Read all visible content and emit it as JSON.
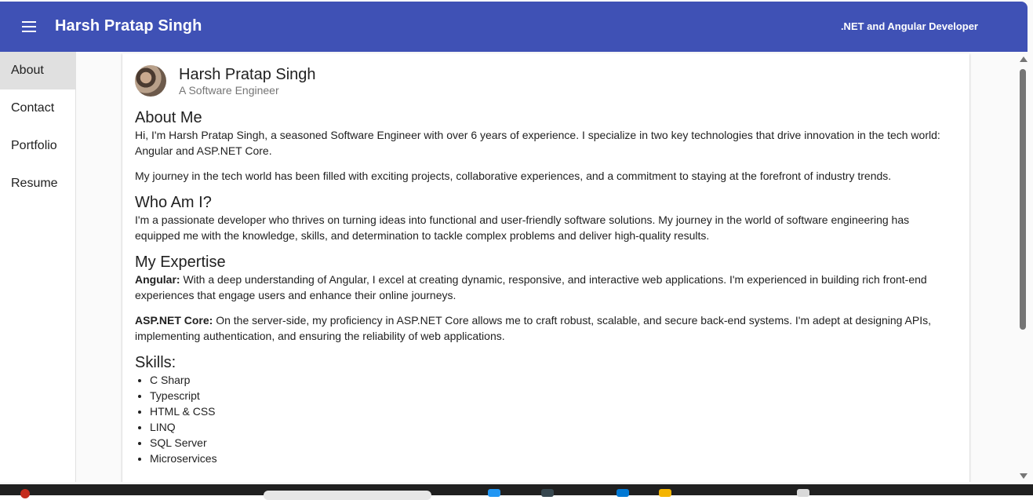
{
  "toolbar": {
    "title": "Harsh Pratap Singh",
    "tagline": ".NET and Angular Developer"
  },
  "sidenav": {
    "items": [
      {
        "label": "About",
        "active": true
      },
      {
        "label": "Contact",
        "active": false
      },
      {
        "label": "Portfolio",
        "active": false
      },
      {
        "label": "Resume",
        "active": false
      }
    ]
  },
  "profile": {
    "name": "Harsh Pratap Singh",
    "subtitle": "A Software Engineer"
  },
  "about": {
    "heading": "About Me",
    "p1": "Hi, I'm Harsh Pratap Singh, a seasoned Software Engineer with over 6 years of experience. I specialize in two key technologies that drive innovation in the tech world: Angular and ASP.NET Core.",
    "p2": "My journey in the tech world has been filled with exciting projects, collaborative experiences, and a commitment to staying at the forefront of industry trends."
  },
  "who": {
    "heading": "Who Am I?",
    "p1": "I'm a passionate developer who thrives on turning ideas into functional and user-friendly software solutions. My journey in the world of software engineering has equipped me with the knowledge, skills, and determination to tackle complex problems and deliver high-quality results."
  },
  "expertise": {
    "heading": "My Expertise",
    "angular_label": "Angular:",
    "angular_text": " With a deep understanding of Angular, I excel at creating dynamic, responsive, and interactive web applications. I'm experienced in building rich front-end experiences that engage users and enhance their online journeys.",
    "aspnet_label": "ASP.NET Core:",
    "aspnet_text": " On the server-side, my proficiency in ASP.NET Core allows me to craft robust, scalable, and secure back-end systems. I'm adept at designing APIs, implementing authentication, and ensuring the reliability of web applications."
  },
  "skills": {
    "heading": "Skills:",
    "items": [
      "C Sharp",
      "Typescript",
      "HTML & CSS",
      "LINQ",
      "SQL Server",
      "Microservices"
    ]
  },
  "colors": {
    "primary": "#3f51b5",
    "active_nav": "#e0e0e0"
  }
}
